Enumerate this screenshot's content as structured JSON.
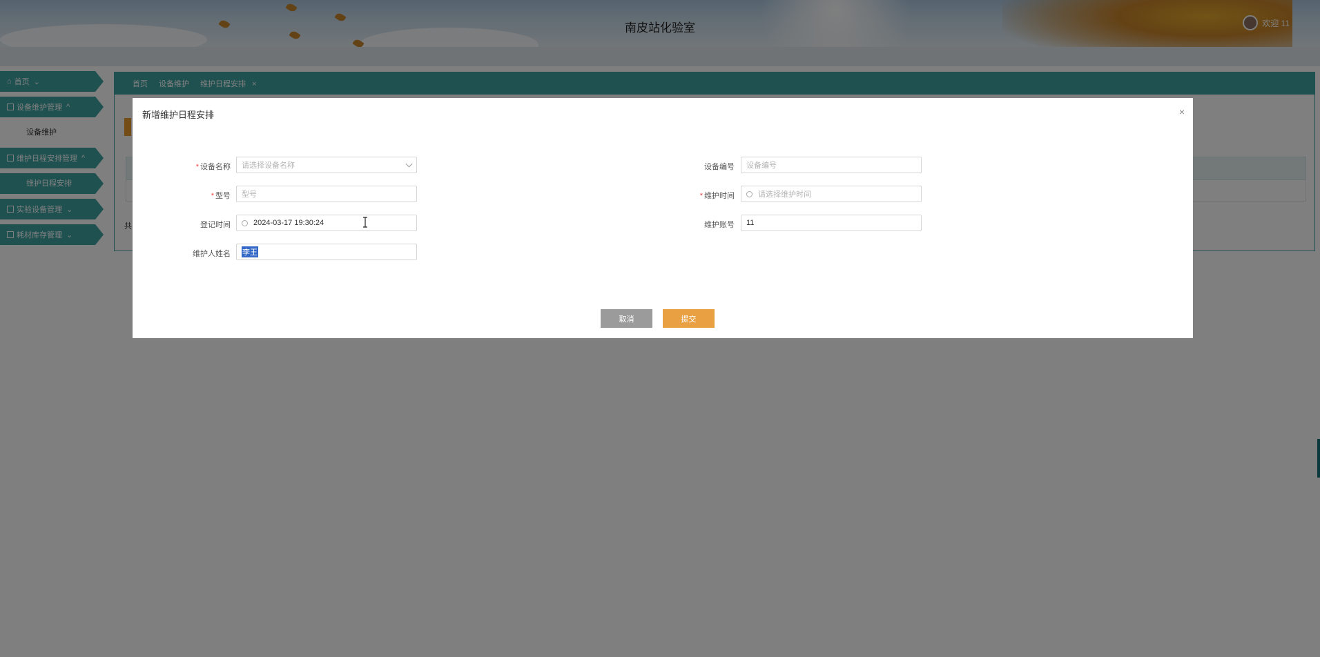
{
  "header": {
    "title": "南皮站化验室",
    "user_text": "欢迎 11"
  },
  "sidebar": {
    "items": [
      {
        "label": "首页",
        "arrow": "⌄"
      },
      {
        "label": "设备维护管理",
        "arrow": "^"
      },
      {
        "sub": "设备维护"
      },
      {
        "label": "维护日程安排管理",
        "arrow": "^"
      },
      {
        "sub": "维护日程安排"
      },
      {
        "label": "实验设备管理",
        "arrow": "⌄"
      },
      {
        "label": "耗材库存管理",
        "arrow": "⌄"
      }
    ]
  },
  "tabs": {
    "home": "首页",
    "maintenance": "设备维护",
    "schedule": "维护日程安排",
    "close": "×"
  },
  "list": {
    "count_prefix": "共"
  },
  "modal": {
    "title": "新增维护日程安排",
    "close": "×",
    "fields": {
      "device_name": {
        "label": "设备名称",
        "placeholder": "请选择设备名称",
        "required": "*"
      },
      "device_code": {
        "label": "设备编号",
        "placeholder": "设备编号"
      },
      "model": {
        "label": "型号",
        "placeholder": "型号",
        "required": "*"
      },
      "maint_time": {
        "label": "维护时间",
        "placeholder": "请选择维护时间",
        "required": "*"
      },
      "reg_time": {
        "label": "登记时间",
        "value": "2024-03-17 19:30:24"
      },
      "maint_account": {
        "label": "维护账号",
        "value": "11"
      },
      "maint_name": {
        "label": "维护人姓名",
        "value": "李王"
      }
    },
    "buttons": {
      "cancel": "取消",
      "submit": "提交"
    }
  },
  "colors": {
    "teal": "#41a3a3",
    "orange": "#e9a043",
    "gray": "#9b9b9b"
  }
}
